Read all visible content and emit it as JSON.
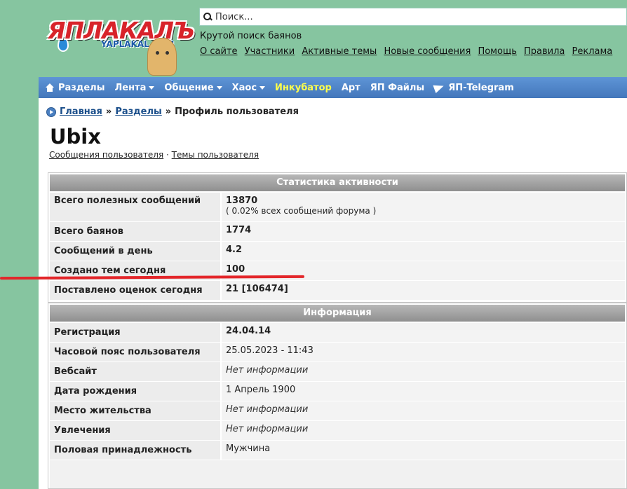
{
  "logo": {
    "text": "ЯПЛАКАЛЪ",
    "sub": "YAPLAKAL.COM"
  },
  "search": {
    "placeholder": "Поиск..."
  },
  "tagline": "Крутой поиск баянов",
  "top_links": [
    "О сайте",
    "Участники",
    "Активные темы",
    "Новые сообщения",
    "Помощь",
    "Правила",
    "Реклама"
  ],
  "nav": {
    "items": [
      {
        "label": "Разделы",
        "dropdown": false
      },
      {
        "label": "Лента",
        "dropdown": true
      },
      {
        "label": "Общение",
        "dropdown": true
      },
      {
        "label": "Хаос",
        "dropdown": true
      },
      {
        "label": "Инкубатор",
        "dropdown": false,
        "highlight": "#ffff4a"
      },
      {
        "label": "Арт",
        "dropdown": false
      },
      {
        "label": "ЯП Файлы",
        "dropdown": false
      },
      {
        "label": "ЯП-Telegram",
        "dropdown": false
      }
    ]
  },
  "breadcrumb": {
    "home": "Главная",
    "sections": "Разделы",
    "current": "Профиль пользователя",
    "sep": "»"
  },
  "profile": {
    "username": "Ubix",
    "links": {
      "messages": "Сообщения пользователя",
      "sep": "·",
      "topics": "Темы пользователя"
    }
  },
  "stats": {
    "title": "Статистика активности",
    "rows": [
      {
        "label": "Всего полезных сообщений",
        "value": "13870",
        "sub": "( 0.02% всех сообщений форума )"
      },
      {
        "label": "Всего баянов",
        "value": "1774"
      },
      {
        "label": "Сообщений в день",
        "value": "4.2"
      },
      {
        "label": "Создано тем сегодня",
        "value": "100"
      },
      {
        "label": "Поставлено оценок сегодня",
        "value": "21 [106474]"
      }
    ]
  },
  "info": {
    "title": "Информация",
    "rows": [
      {
        "label": "Регистрация",
        "value": "24.04.14"
      },
      {
        "label": "Часовой пояс пользователя",
        "value": "25.05.2023 - 11:43"
      },
      {
        "label": "Вебсайт",
        "value": "Нет информации"
      },
      {
        "label": "Дата рождения",
        "value": "1 Апрель 1900"
      },
      {
        "label": "Место жительства",
        "value": "Нет информации"
      },
      {
        "label": "Увлечения",
        "value": "Нет информации"
      },
      {
        "label": "Половая принадлежность",
        "value": "Мужчина"
      }
    ]
  },
  "colors": {
    "background": "#86c5a0",
    "nav": "#4f86c8",
    "annotation": "#e3262a"
  }
}
